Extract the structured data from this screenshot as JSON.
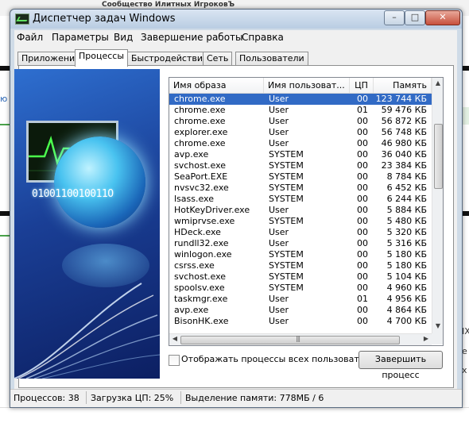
{
  "background": {
    "top_text": "Сообщество Илитных ИгроковЪ",
    "left_link": "ю",
    "right_texts": [
      "IX",
      "e",
      "x"
    ]
  },
  "window": {
    "title": "Диспетчер задач Windows",
    "controls": {
      "minimize": "–",
      "maximize": "□",
      "close": "✕"
    }
  },
  "menu": [
    "Файл",
    "Параметры",
    "Вид",
    "Завершение работы",
    "Справка"
  ],
  "tabs": [
    "Приложения",
    "Процессы",
    "Быстродействие",
    "Сеть",
    "Пользователи"
  ],
  "active_tab": "Процессы",
  "banner": {
    "binary_text": "0100110010011O"
  },
  "columns": [
    "Имя образа",
    "Имя пользоват...",
    "ЦП",
    "Память"
  ],
  "processes": [
    {
      "name": "chrome.exe",
      "user": "User",
      "cpu": "00",
      "mem": "123 744 КБ",
      "selected": true
    },
    {
      "name": "chrome.exe",
      "user": "User",
      "cpu": "01",
      "mem": "59 476 КБ"
    },
    {
      "name": "chrome.exe",
      "user": "User",
      "cpu": "00",
      "mem": "56 872 КБ"
    },
    {
      "name": "explorer.exe",
      "user": "User",
      "cpu": "00",
      "mem": "56 748 КБ"
    },
    {
      "name": "chrome.exe",
      "user": "User",
      "cpu": "00",
      "mem": "46 980 КБ"
    },
    {
      "name": "avp.exe",
      "user": "SYSTEM",
      "cpu": "00",
      "mem": "36 040 КБ"
    },
    {
      "name": "svchost.exe",
      "user": "SYSTEM",
      "cpu": "00",
      "mem": "23 384 КБ"
    },
    {
      "name": "SeaPort.EXE",
      "user": "SYSTEM",
      "cpu": "00",
      "mem": "8 784 КБ"
    },
    {
      "name": "nvsvc32.exe",
      "user": "SYSTEM",
      "cpu": "00",
      "mem": "6 452 КБ"
    },
    {
      "name": "lsass.exe",
      "user": "SYSTEM",
      "cpu": "00",
      "mem": "6 244 КБ"
    },
    {
      "name": "HotKeyDriver.exe",
      "user": "User",
      "cpu": "00",
      "mem": "5 884 КБ"
    },
    {
      "name": "wmiprvse.exe",
      "user": "SYSTEM",
      "cpu": "00",
      "mem": "5 480 КБ"
    },
    {
      "name": "HDeck.exe",
      "user": "User",
      "cpu": "00",
      "mem": "5 320 КБ"
    },
    {
      "name": "rundll32.exe",
      "user": "User",
      "cpu": "00",
      "mem": "5 316 КБ"
    },
    {
      "name": "winlogon.exe",
      "user": "SYSTEM",
      "cpu": "00",
      "mem": "5 180 КБ"
    },
    {
      "name": "csrss.exe",
      "user": "SYSTEM",
      "cpu": "00",
      "mem": "5 180 КБ"
    },
    {
      "name": "svchost.exe",
      "user": "SYSTEM",
      "cpu": "00",
      "mem": "5 104 КБ"
    },
    {
      "name": "spoolsv.exe",
      "user": "SYSTEM",
      "cpu": "00",
      "mem": "4 960 КБ"
    },
    {
      "name": "taskmgr.exe",
      "user": "User",
      "cpu": "01",
      "mem": "4 956 КБ"
    },
    {
      "name": "avp.exe",
      "user": "User",
      "cpu": "00",
      "mem": "4 864 КБ"
    },
    {
      "name": "BisonHK.exe",
      "user": "User",
      "cpu": "00",
      "mem": "4 700 КБ"
    }
  ],
  "show_all_processes_label": "Отображать процессы всех пользователей",
  "show_all_processes_checked": false,
  "end_process_label": "Завершить процесс",
  "status": {
    "processes": "Процессов: 38",
    "cpu": "Загрузка ЦП: 25%",
    "memory": "Выделение памяти: 778МБ / 6"
  },
  "colors": {
    "selection": "#316ac5",
    "titlebar": "#b9cde2",
    "banner": "#1a3f96"
  }
}
